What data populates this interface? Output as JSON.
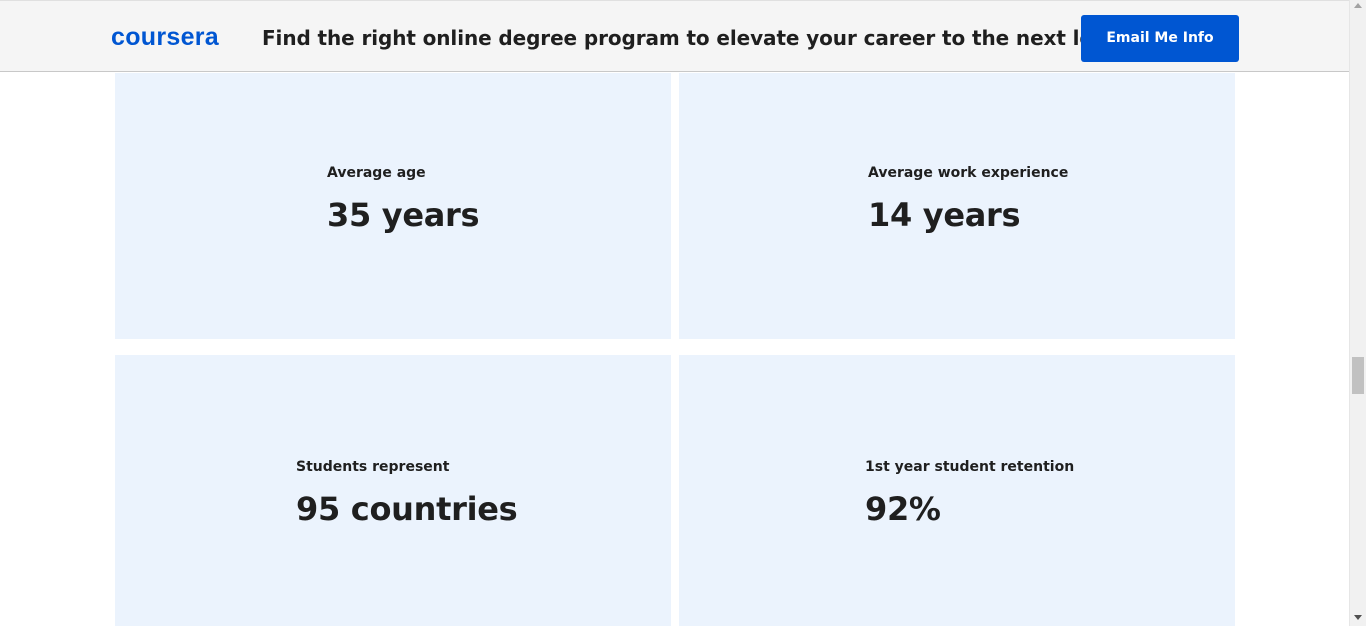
{
  "banner": {
    "logo_text": "coursera",
    "headline": "Find the right online degree program to elevate your career to the next level",
    "cta_label": "Email Me Info"
  },
  "stats": {
    "average_age": {
      "label": "Average age",
      "value": "35 years"
    },
    "average_experience": {
      "label": "Average work experience",
      "value": "14 years"
    },
    "countries": {
      "label": "Students represent",
      "value": "95 countries"
    },
    "retention": {
      "label": "1st year student retention",
      "value": "92%"
    }
  },
  "colors": {
    "brand": "#0056d2",
    "card_background": "#ebf3fd",
    "text": "#1f1f1f",
    "banner_background": "#f5f5f5"
  }
}
